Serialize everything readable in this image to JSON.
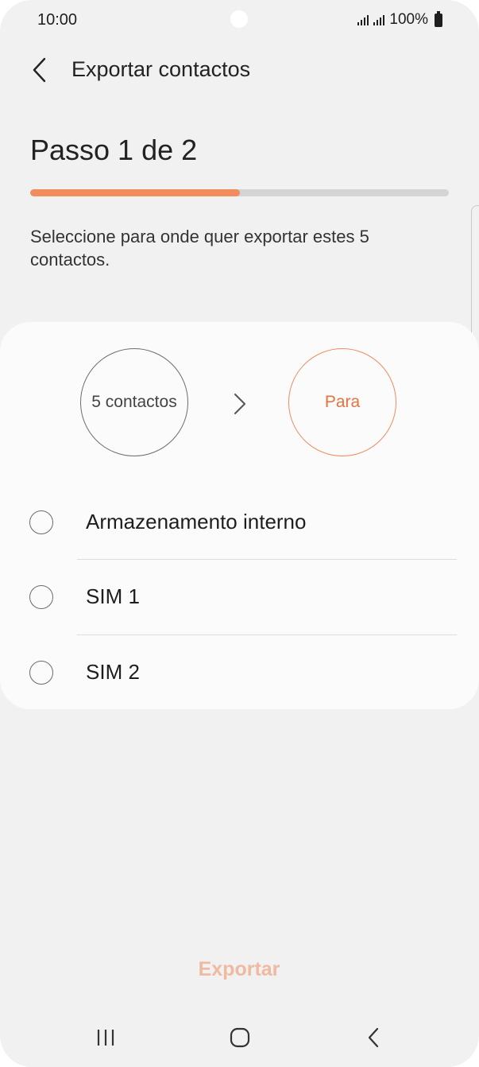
{
  "status_bar": {
    "time": "10:00",
    "battery": "100%"
  },
  "header": {
    "title": "Exportar contactos"
  },
  "step": {
    "label": "Passo 1 de 2",
    "progress_fraction": 0.5
  },
  "description": "Seleccione para onde quer exportar estes 5 contactos.",
  "flow": {
    "source_label": "5 contactos",
    "destination_label": "Para"
  },
  "options": [
    {
      "label": "Armazenamento interno",
      "selected": false
    },
    {
      "label": "SIM 1",
      "selected": false
    },
    {
      "label": "SIM 2",
      "selected": false
    }
  ],
  "export_button": {
    "label": "Exportar",
    "enabled": false
  },
  "colors": {
    "accent": "#f08c5e",
    "accent_text": "#e4733f",
    "disabled_text": "#f0b9a1"
  },
  "icons": [
    "back-icon",
    "chevron-right-icon",
    "recent-apps-icon",
    "home-icon",
    "nav-back-icon"
  ]
}
